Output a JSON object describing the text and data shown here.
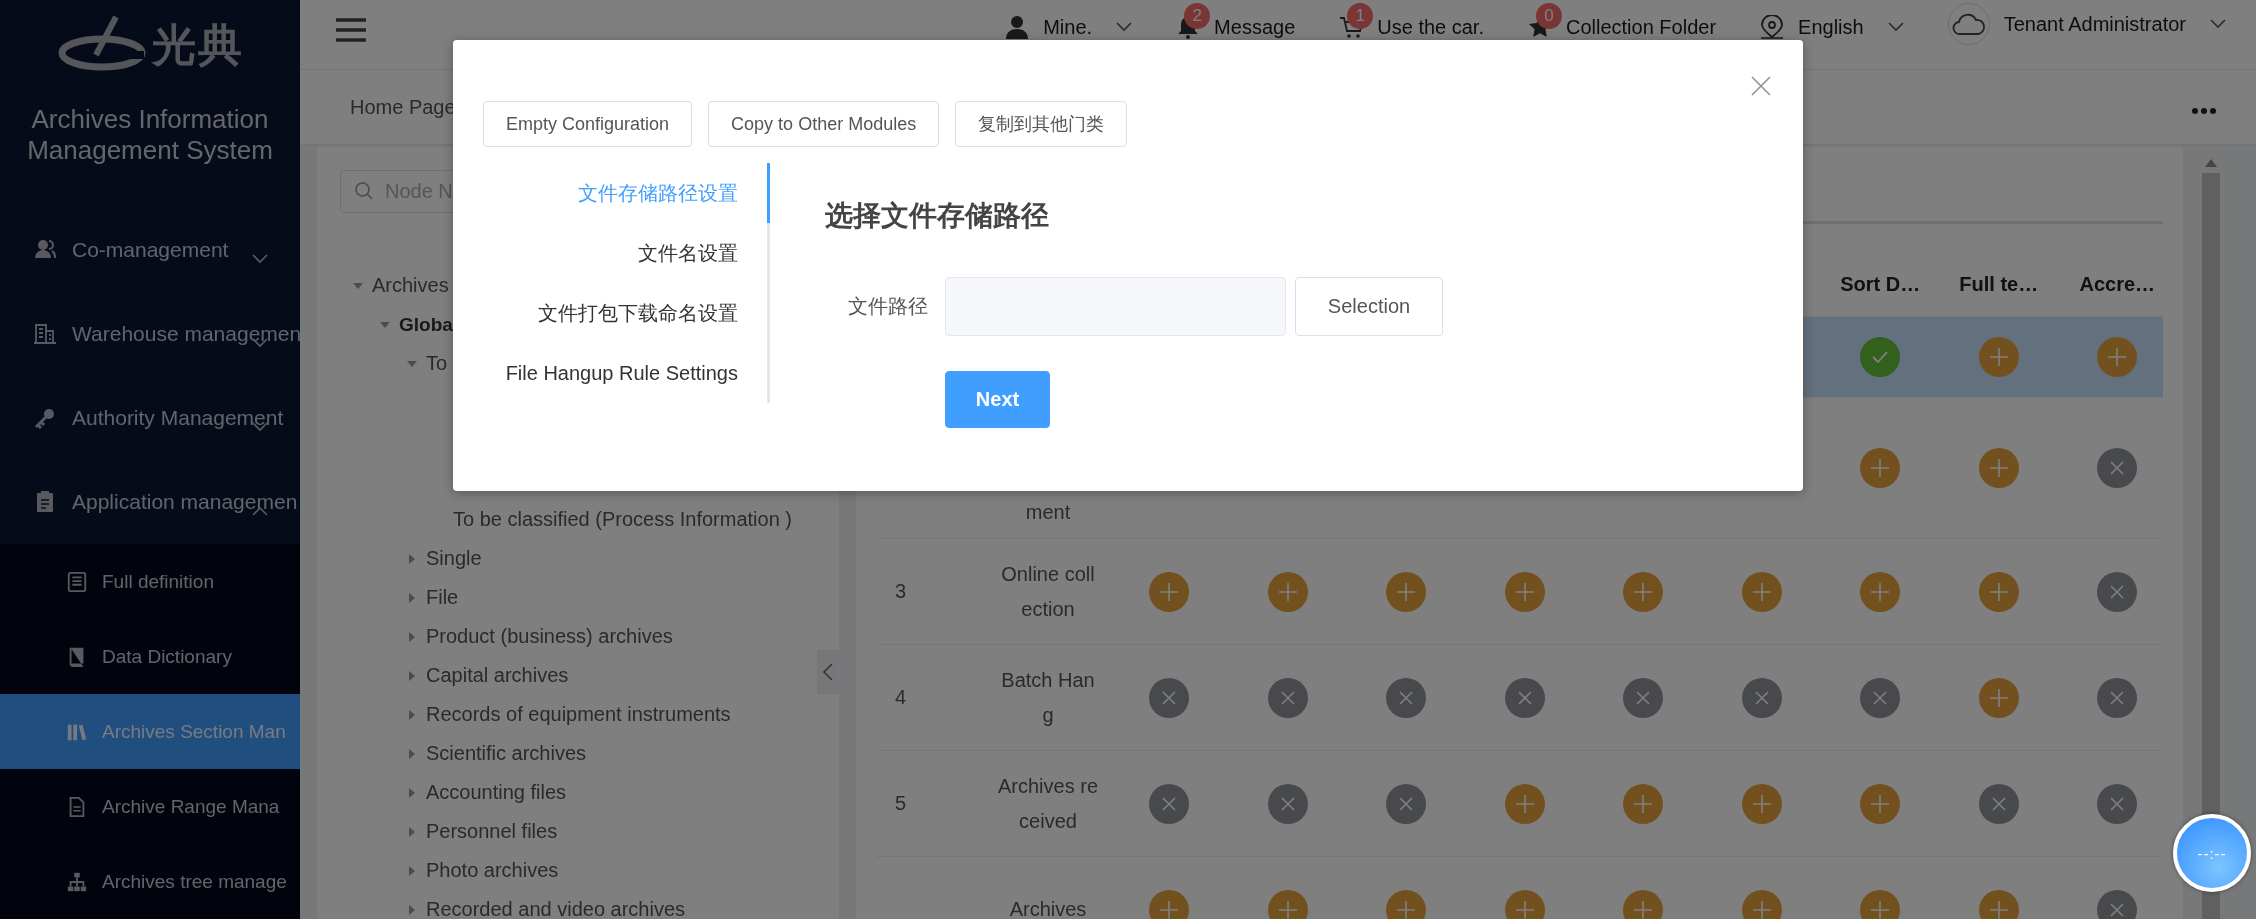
{
  "sidebar": {
    "logo_text": "光典",
    "title": "Archives Information Management System",
    "menu": [
      {
        "label": "Co-management",
        "expanded": false
      },
      {
        "label": "Warehouse managemen",
        "expanded": false
      },
      {
        "label": "Authority Management",
        "expanded": false
      },
      {
        "label": "Application managemen",
        "expanded": true,
        "children": [
          {
            "label": "Full definition",
            "selected": false
          },
          {
            "label": "Data Dictionary",
            "selected": false
          },
          {
            "label": "Archives Section Man",
            "selected": true
          },
          {
            "label": "Archive Range Mana",
            "selected": false
          },
          {
            "label": "Archives tree manage",
            "selected": false
          }
        ]
      }
    ]
  },
  "header": {
    "items": [
      {
        "label": "Mine.",
        "dropdown": true
      },
      {
        "label": "Message",
        "badge": "2",
        "dropdown": false
      },
      {
        "label": "Use the car.",
        "badge": "1",
        "dropdown": false
      },
      {
        "label": "Collection Folder",
        "badge": "0",
        "dropdown": false
      },
      {
        "label": "English",
        "dropdown": true
      },
      {
        "label": "Tenant Administrator",
        "dropdown": true
      }
    ]
  },
  "tabs": [
    {
      "label": "Home Page"
    }
  ],
  "tree": {
    "search": {
      "placeholder": "Node N"
    },
    "nodes": [
      {
        "label": "Archives",
        "expanded": true,
        "children": [
          {
            "label": "Globa",
            "expanded": true,
            "children": [
              {
                "label": "To",
                "expanded": true,
                "children": [
                  {
                    "label": "To be classified (Process Information )"
                  }
                ]
              },
              {
                "label": "Single",
                "expanded": false
              },
              {
                "label": "File",
                "expanded": false
              },
              {
                "label": "Product (business) archives",
                "expanded": false
              },
              {
                "label": "Capital archives",
                "expanded": false
              },
              {
                "label": "Records of equipment instruments",
                "expanded": false
              },
              {
                "label": "Scientific archives",
                "expanded": false
              },
              {
                "label": "Accounting files",
                "expanded": false
              },
              {
                "label": "Personnel files",
                "expanded": false
              },
              {
                "label": "Photo archives",
                "expanded": false
              },
              {
                "label": "Recorded and video archives",
                "expanded": false
              }
            ]
          }
        ]
      }
    ]
  },
  "table": {
    "headers": [
      "Sort D…",
      "Full te…",
      "Accre…"
    ],
    "rows": [
      {
        "selected": true,
        "states": [
          {
            "kind": "done"
          },
          {
            "kind": "add"
          },
          {
            "kind": "add"
          }
        ]
      },
      {
        "selected": false,
        "name": "ment",
        "states": [
          {
            "kind": "add"
          },
          {
            "kind": "add"
          },
          {
            "kind": "none"
          }
        ]
      },
      {
        "selected": false,
        "number": "3",
        "name": "Online collection",
        "states": [
          {
            "kind": "add"
          },
          {
            "kind": "add"
          },
          {
            "kind": "add"
          },
          {
            "kind": "add"
          },
          {
            "kind": "add"
          },
          {
            "kind": "add"
          },
          {
            "kind": "add"
          },
          {
            "kind": "add"
          },
          {
            "kind": "none"
          }
        ]
      },
      {
        "selected": false,
        "number": "4",
        "name": "Batch Hang",
        "states": [
          {
            "kind": "none"
          },
          {
            "kind": "none"
          },
          {
            "kind": "none"
          },
          {
            "kind": "none"
          },
          {
            "kind": "none"
          },
          {
            "kind": "none"
          },
          {
            "kind": "none"
          },
          {
            "kind": "add"
          },
          {
            "kind": "none"
          }
        ]
      },
      {
        "selected": false,
        "number": "5",
        "name": "Archives received",
        "states": [
          {
            "kind": "none"
          },
          {
            "kind": "none"
          },
          {
            "kind": "none"
          },
          {
            "kind": "add"
          },
          {
            "kind": "add"
          },
          {
            "kind": "add"
          },
          {
            "kind": "add"
          },
          {
            "kind": "none"
          },
          {
            "kind": "none"
          }
        ]
      },
      {
        "selected": false,
        "name": "Archives",
        "states": [
          {
            "kind": "add"
          },
          {
            "kind": "add"
          },
          {
            "kind": "add"
          },
          {
            "kind": "add"
          },
          {
            "kind": "add"
          },
          {
            "kind": "add"
          },
          {
            "kind": "add"
          },
          {
            "kind": "add"
          },
          {
            "kind": "none"
          }
        ]
      }
    ]
  },
  "dialog": {
    "buttons": [
      "Empty Configuration",
      "Copy to Other Modules",
      "复制到其他门类"
    ],
    "steps": [
      {
        "label": "文件存储路径设置",
        "selected": true
      },
      {
        "label": "文件名设置",
        "selected": false
      },
      {
        "label": "文件打包下载命名设置",
        "selected": false
      },
      {
        "label": "File Hangup Rule Settings",
        "selected": false
      }
    ],
    "heading": "选择文件存储路径",
    "field_label": "文件路径",
    "select_button": "Selection",
    "next_button": "Next"
  },
  "clock": {
    "text": "--:--"
  }
}
